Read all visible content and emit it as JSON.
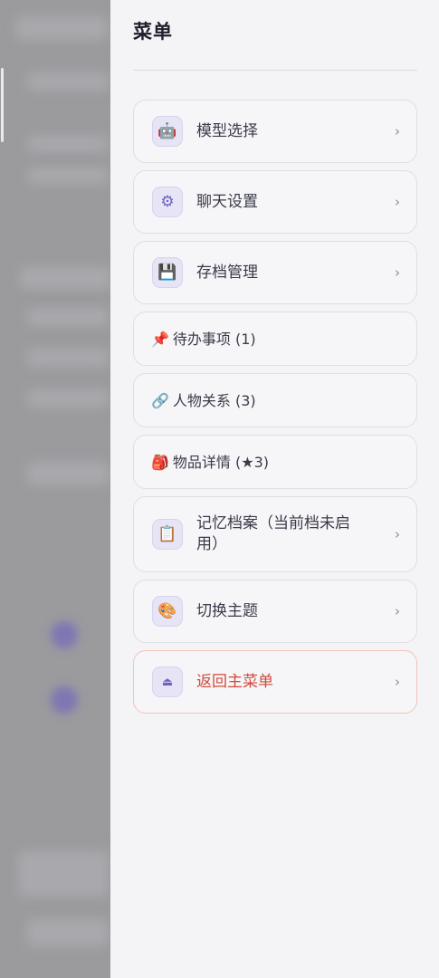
{
  "drawer": {
    "title": "菜单"
  },
  "menu": {
    "items": [
      {
        "icon": "robot-icon",
        "glyph": "🤖",
        "label": "模型选择",
        "chevron": "›"
      },
      {
        "icon": "gear-icon",
        "glyph": "⚙",
        "label": "聊天设置",
        "chevron": "›"
      },
      {
        "icon": "floppy-disk-icon",
        "glyph": "💾",
        "label": "存档管理",
        "chevron": "›"
      },
      {
        "icon": "pushpin-icon",
        "glyph": "📌",
        "label": "待办事项 (1)"
      },
      {
        "icon": "link-icon",
        "glyph": "🔗",
        "label": "人物关系 (3)"
      },
      {
        "icon": "backpack-icon",
        "glyph": "🎒",
        "label": "物品详情 (★3)"
      },
      {
        "icon": "clipboard-icon",
        "glyph": "📋",
        "label": "记忆档案（当前档未启用）",
        "chevron": "›"
      },
      {
        "icon": "palette-icon",
        "glyph": "🎨",
        "label": "切换主题",
        "chevron": "›"
      },
      {
        "icon": "eject-icon",
        "glyph": "⏏",
        "label": "返回主菜单",
        "chevron": "›"
      }
    ]
  },
  "colors": {
    "danger": "#d2493a",
    "accent": "#6d63c2"
  }
}
